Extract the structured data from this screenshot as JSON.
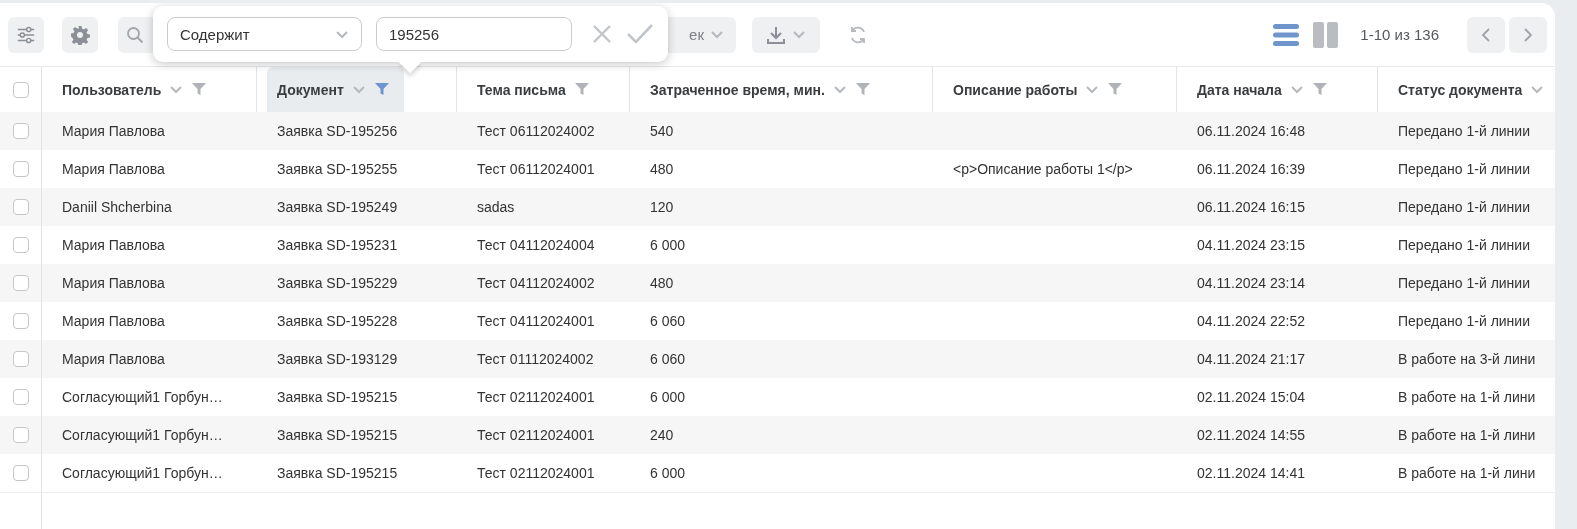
{
  "toolbar": {
    "partial_button": {
      "label": "ек"
    },
    "pagination": {
      "range": "1-10 из 136"
    },
    "view_modes": [
      {
        "kind": "list",
        "selected": true
      },
      {
        "kind": "columns",
        "selected": false
      }
    ]
  },
  "filter_popup": {
    "operator": "Содержит",
    "value": "195256"
  },
  "table": {
    "select_all": {
      "checked": false
    },
    "columns": [
      {
        "label": "Пользователь",
        "sortable": true,
        "filterable": true,
        "filtered": false
      },
      {
        "label": "Документ",
        "sortable": true,
        "filterable": true,
        "filtered": true
      },
      {
        "label": "Тема письма",
        "sortable": false,
        "filterable": true,
        "filtered": false
      },
      {
        "label": "Затраченное время, мин.",
        "sortable": true,
        "filterable": true,
        "filtered": false
      },
      {
        "label": "Описание работы",
        "sortable": true,
        "filterable": true,
        "filtered": false
      },
      {
        "label": "Дата начала",
        "sortable": true,
        "filterable": true,
        "filtered": false
      },
      {
        "label": "Статус документа",
        "sortable": true,
        "filterable": false,
        "filtered": false
      }
    ],
    "rows": [
      {
        "checked": false,
        "cells": [
          "Мария Павлова",
          "Заявка SD-195256",
          "Тест 06112024002",
          "540",
          "",
          "06.11.2024 16:48",
          "Передано 1-й линии"
        ]
      },
      {
        "checked": false,
        "cells": [
          "Мария Павлова",
          "Заявка SD-195255",
          "Тест 06112024001",
          "480",
          "<p>Описание работы 1</p>",
          "06.11.2024 16:39",
          "Передано 1-й линии"
        ]
      },
      {
        "checked": false,
        "cells": [
          "Daniil Shcherbina",
          "Заявка SD-195249",
          "sadas",
          "120",
          "",
          "06.11.2024 16:15",
          "Передано 1-й линии"
        ]
      },
      {
        "checked": false,
        "cells": [
          "Мария Павлова",
          "Заявка SD-195231",
          "Тест 04112024004",
          "6 000",
          "",
          "04.11.2024 23:15",
          "Передано 1-й линии"
        ]
      },
      {
        "checked": false,
        "cells": [
          "Мария Павлова",
          "Заявка SD-195229",
          "Тест 04112024002",
          "480",
          "",
          "04.11.2024 23:14",
          "Передано 1-й линии"
        ]
      },
      {
        "checked": false,
        "cells": [
          "Мария Павлова",
          "Заявка SD-195228",
          "Тест 04112024001",
          "6 060",
          "",
          "04.11.2024 22:52",
          "Передано 1-й линии"
        ]
      },
      {
        "checked": false,
        "cells": [
          "Мария Павлова",
          "Заявка SD-193129",
          "Тест 01112024002",
          "6 060",
          "",
          "04.11.2024 21:17",
          "В работе на 3-й лини"
        ]
      },
      {
        "checked": false,
        "cells": [
          "Согласующий1 Горбун…",
          "Заявка SD-195215",
          "Тест 02112024001",
          "6 000",
          "",
          "02.11.2024 15:04",
          "В работе на 1-й лини"
        ]
      },
      {
        "checked": false,
        "cells": [
          "Согласующий1 Горбун…",
          "Заявка SD-195215",
          "Тест 02112024001",
          "240",
          "",
          "02.11.2024 14:55",
          "В работе на 1-й лини"
        ]
      },
      {
        "checked": false,
        "cells": [
          "Согласующий1 Горбун…",
          "Заявка SD-195215",
          "Тест 02112024001",
          "6 000",
          "",
          "02.11.2024 14:41",
          "В работе на 1-й лини"
        ]
      }
    ]
  }
}
